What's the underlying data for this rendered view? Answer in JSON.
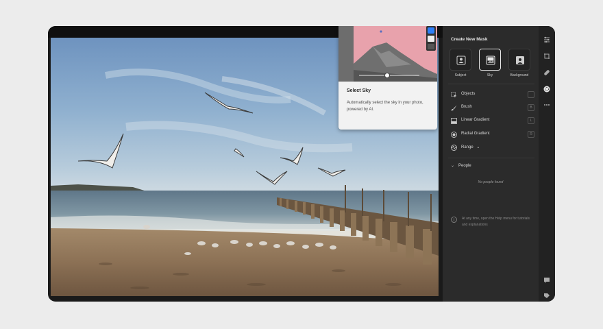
{
  "popover": {
    "title": "Select Sky",
    "description": "Automatically select the sky in your photo, powered by AI."
  },
  "panel": {
    "title": "Create New Mask",
    "mask_options": [
      {
        "label": "Subject",
        "icon": "subject-icon"
      },
      {
        "label": "Sky",
        "icon": "sky-icon",
        "active": true
      },
      {
        "label": "Background",
        "icon": "background-icon"
      }
    ],
    "tools": [
      {
        "label": "Objects",
        "icon": "objects-icon",
        "shortcut": ""
      },
      {
        "label": "Brush",
        "icon": "brush-icon",
        "shortcut": "B"
      },
      {
        "label": "Linear Gradient",
        "icon": "linear-gradient-icon",
        "shortcut": "L"
      },
      {
        "label": "Radial Gradient",
        "icon": "radial-gradient-icon",
        "shortcut": "R"
      },
      {
        "label": "Range",
        "icon": "range-icon",
        "shortcut": ""
      }
    ],
    "people_heading": "People",
    "people_empty": "No people found",
    "help_text": "At any time, open the Help menu for tutorials and explanations"
  },
  "colors": {
    "panel_bg": "#2b2b2b",
    "rail_bg": "#222222",
    "popover_bg": "#f2f2f2",
    "accent_blue": "#2d7ff9"
  }
}
